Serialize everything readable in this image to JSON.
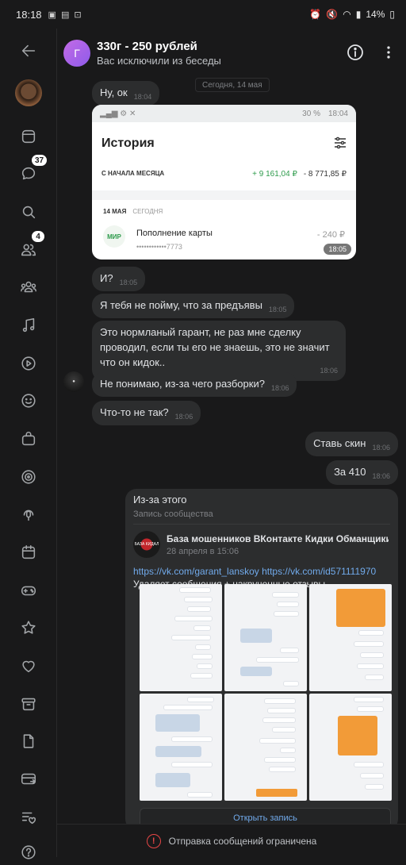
{
  "status_bar": {
    "time": "18:18",
    "battery": "14%"
  },
  "rail": {
    "messages_badge": "37",
    "friends_badge": "4"
  },
  "header": {
    "avatar_letter": "Г",
    "title": "330г - 250 рублей",
    "subtitle": "Вас исключили из беседы"
  },
  "feed": {
    "date_chip": "Сегодня, 14 мая",
    "m1": {
      "text": "Ну, ок",
      "time": "18:04"
    },
    "screenshot": {
      "time": "18:05",
      "status_time": "18:04",
      "status_battery": "30 %",
      "title": "История",
      "period": "С НАЧАЛА МЕСЯЦА",
      "income": "+ 9 161,04 ₽",
      "expense": "- 8 771,85 ₽",
      "date": "14 МАЯ",
      "date_sub": "СЕГОДНЯ",
      "icon_label": "МИР",
      "operation": "Пополнение карты",
      "card_mask": "••••••••••••7773",
      "amount": "- 240 ₽"
    },
    "m2": {
      "text": "И?",
      "time": "18:05"
    },
    "m3": {
      "text": "Я тебя не пойму, что за предъявы",
      "time": "18:05"
    },
    "m4": {
      "text": "Это нормланый гарант, не раз мне сделку проводил, если ты его не знаешь, это не значит что он кидок..",
      "time": "18:06"
    },
    "m5": {
      "text": "Не понимаю, из-за чего разборки?",
      "time": "18:06"
    },
    "m6": {
      "text": "Что-то не так?",
      "time": "18:06"
    },
    "o1": {
      "text": "Ставь скин",
      "time": "18:06"
    },
    "o2": {
      "text": "За 410",
      "time": "18:06"
    },
    "repost": {
      "caption": "Из-за этого",
      "label": "Запись сообщества",
      "community": "База мошенников ВКонтакте  Кидки Обманщики...",
      "date": "28 апреля в 15:06",
      "links": "https://vk.com/garant_lanskoy https://vk.com/id571111970",
      "text": "Удаляет сообщения + накрученные отзывы",
      "open_label": "Открыть запись"
    }
  },
  "footer": {
    "text": "Отправка сообщений ограничена"
  }
}
